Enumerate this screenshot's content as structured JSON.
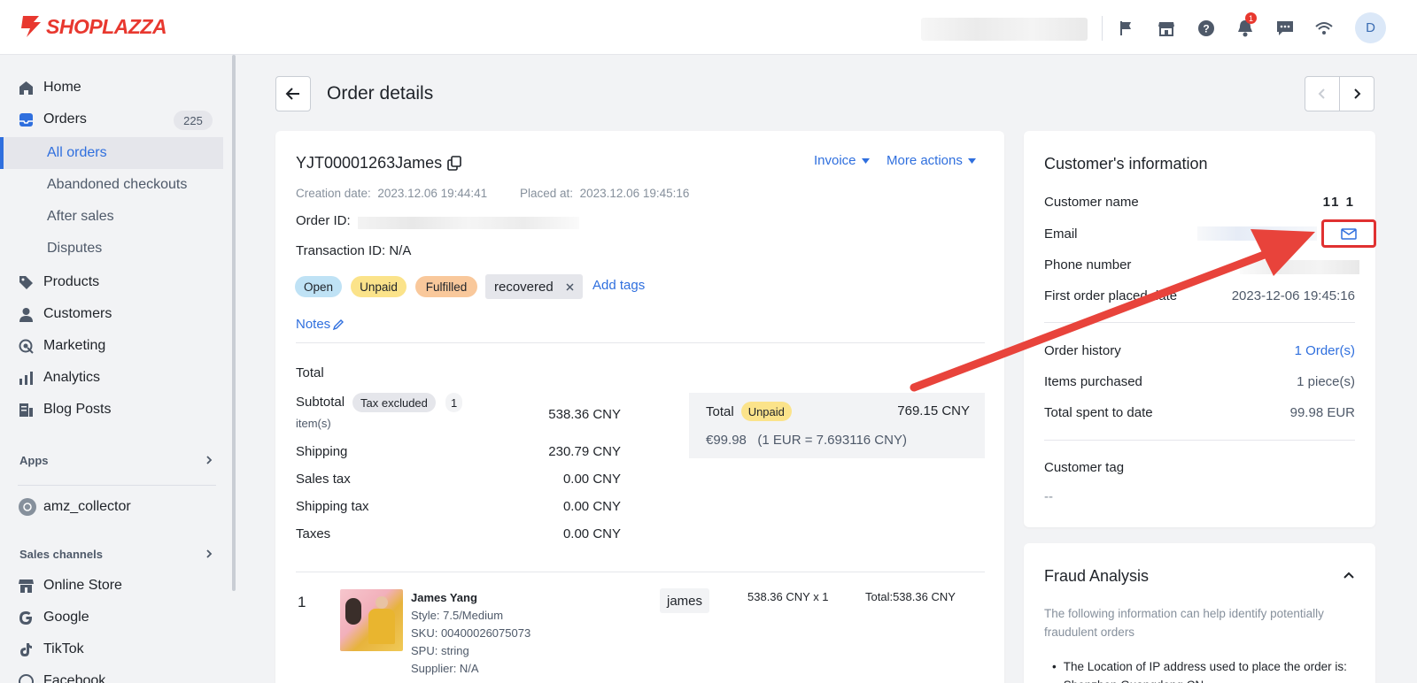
{
  "brand": {
    "name": "SHOPLAZZA",
    "color": "#e8382f"
  },
  "topbar": {
    "icons": [
      "flag-icon",
      "store-icon",
      "help-icon",
      "bell-icon",
      "chat-icon",
      "wifi-icon"
    ],
    "notification_count": "1",
    "avatar_initial": "D"
  },
  "sidebar": {
    "home": "Home",
    "orders": "Orders",
    "orders_count": "225",
    "all_orders": "All orders",
    "abandoned": "Abandoned checkouts",
    "after_sales": "After sales",
    "disputes": "Disputes",
    "products": "Products",
    "customers": "Customers",
    "marketing": "Marketing",
    "analytics": "Analytics",
    "blog_posts": "Blog Posts",
    "apps_header": "Apps",
    "app_item": "amz_collector",
    "sales_channels_header": "Sales channels",
    "online_store": "Online Store",
    "google": "Google",
    "tiktok": "TikTok",
    "facebook": "Facebook"
  },
  "header": {
    "title": "Order details"
  },
  "order": {
    "number": "YJT00001263James",
    "invoice": "Invoice",
    "more_actions": "More actions",
    "creation_label": "Creation date:",
    "creation_date": "2023.12.06 19:44:41",
    "placed_label": "Placed at:",
    "placed_date": "2023.12.06 19:45:16",
    "order_id_label": "Order ID:",
    "transaction_id": "Transaction ID: N/A",
    "tags": {
      "open": "Open",
      "unpaid": "Unpaid",
      "fulfilled": "Fulfilled",
      "recovered": "recovered",
      "add_tags": "Add tags"
    },
    "notes": "Notes",
    "total_header": "Total",
    "subtotal_label": "Subtotal",
    "tax_excluded": "Tax excluded",
    "items_count_a": "1",
    "items_count_b": "item(s)",
    "subtotal": "538.36 CNY",
    "shipping_label": "Shipping",
    "shipping": "230.79 CNY",
    "sales_tax_label": "Sales tax",
    "sales_tax": "0.00 CNY",
    "shipping_tax_label": "Shipping tax",
    "shipping_tax": "0.00 CNY",
    "taxes_label": "Taxes",
    "taxes": "0.00 CNY",
    "total_label": "Total",
    "total_status": "Unpaid",
    "total": "769.15 CNY",
    "eur_total": "€99.98",
    "exchange": "(1 EUR = 7.693116 CNY)",
    "line_item": {
      "index": "1",
      "name": "James Yang",
      "style": "Style: 7.5/Medium",
      "sku": "SKU: 00400026075073",
      "spu": "SPU: string",
      "supplier": "Supplier: N/A",
      "vendor_tag": "james",
      "price_qty": "538.36 CNY x 1",
      "line_total": "Total:538.36 CNY"
    }
  },
  "customer": {
    "title": "Customer's information",
    "name_label": "Customer name",
    "name": "11 1",
    "email_label": "Email",
    "phone_label": "Phone number",
    "first_order_label": "First order placed date",
    "first_order": "2023-12-06 19:45:16",
    "history_label": "Order history",
    "history": "1 Order(s)",
    "items_label": "Items purchased",
    "items": "1 piece(s)",
    "spent_label": "Total spent to date",
    "spent": "99.98 EUR",
    "tag_label": "Customer tag",
    "tag_value": "--"
  },
  "fraud": {
    "title": "Fraud Analysis",
    "desc": "The following information can help identify potentially fraudulent orders",
    "bullet": "The Location of IP address used to place the order is: Shenzhen Guangdong CN"
  },
  "colors": {
    "accent": "#2f6fde",
    "annotation": "#e8433b"
  }
}
